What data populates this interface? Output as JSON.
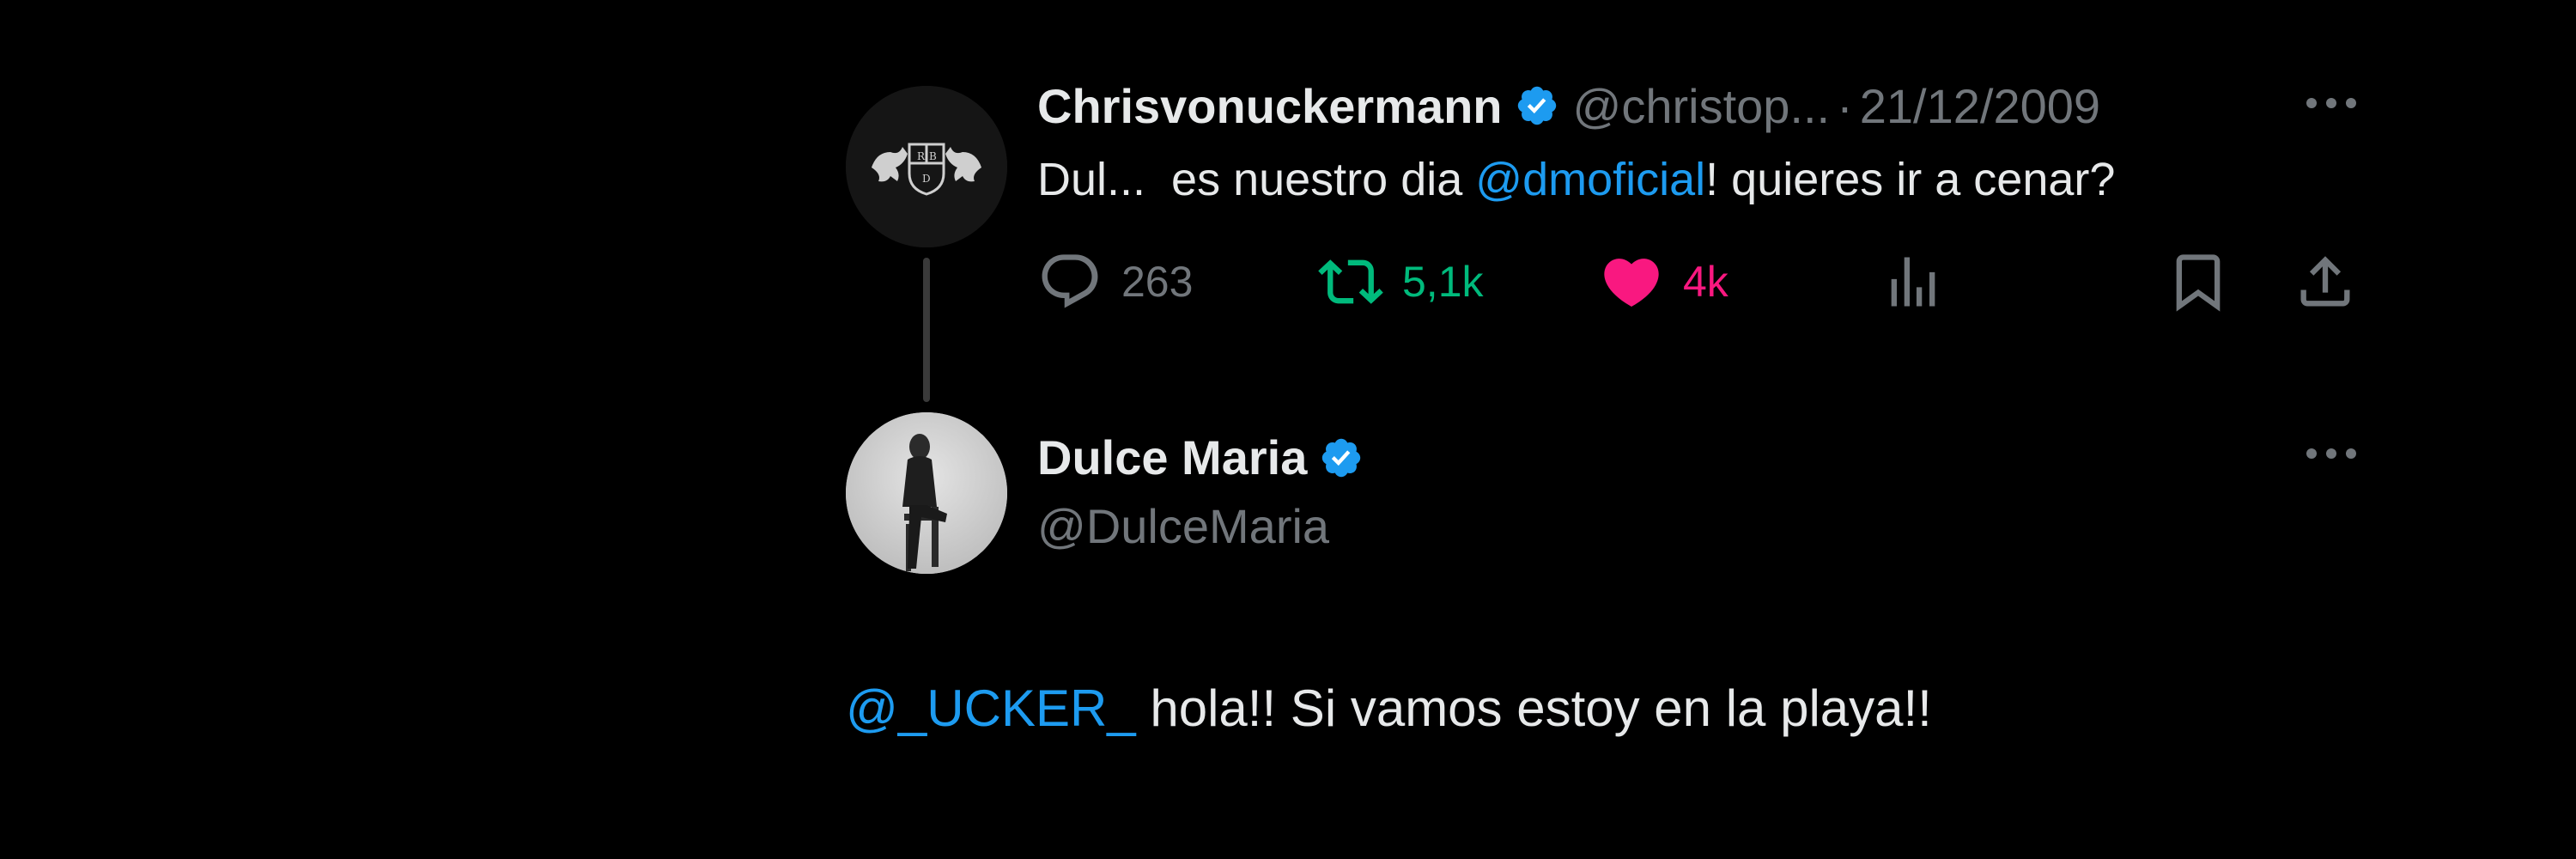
{
  "tweet1": {
    "author_name": "Chrisvonuckermann",
    "handle": "@christop...",
    "separator": "·",
    "date": "21/12/2009",
    "text_before": "Dul...  es nuestro dia ",
    "mention": "@dmoficial",
    "text_after": "! quieres ir a cenar?",
    "replies": "263",
    "retweets": "5,1k",
    "likes": "4k",
    "avatar_icon": "rbd-logo-icon"
  },
  "tweet2": {
    "author_name": "Dulce Maria",
    "handle": "@DulceMaria",
    "mention": "@_UCKER_",
    "text": " hola!! Si vamos estoy en la playa!!",
    "avatar_icon": "profile-photo-icon"
  },
  "colors": {
    "background": "#000000",
    "text": "#e7e9ea",
    "muted": "#71767b",
    "link": "#1d9bf0",
    "retweet": "#00ba7c",
    "like": "#f91880",
    "verified": "#1d9bf0"
  },
  "icons": [
    "verified-badge-icon",
    "more-icon",
    "reply-icon",
    "retweet-icon",
    "like-icon",
    "views-icon",
    "bookmark-icon",
    "share-icon"
  ]
}
